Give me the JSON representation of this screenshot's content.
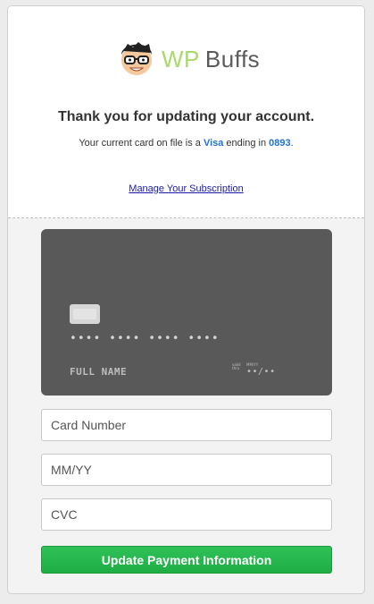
{
  "brand": {
    "logo_primary": "WP",
    "logo_secondary": "Buffs",
    "colors": {
      "logo_primary": "#a8d96a",
      "logo_secondary": "#5b5b5b"
    },
    "mascot_icon": "nerd-face-icon"
  },
  "header": {
    "title": "Thank you for updating your account.",
    "card_info_prefix": "Your current card on file is a ",
    "card_brand": "Visa",
    "card_info_middle": " ending in ",
    "card_last4": "0893",
    "card_info_suffix": ".",
    "manage_link_label": "Manage Your Subscription",
    "colors": {
      "highlight": "#1e73d6",
      "link": "#1a1aa8"
    }
  },
  "card_preview": {
    "number_mask": "•••• •••• •••• ••••",
    "name_placeholder": "FULL NAME",
    "valid_thru_label": "valid thru",
    "expiry_label": "MM/YY",
    "expiry_mask": "••/••",
    "chip_icon": "card-chip-icon",
    "colors": {
      "card_background": "#595959"
    }
  },
  "form": {
    "card_number_placeholder": "Card Number",
    "expiry_placeholder": "MM/YY",
    "cvc_placeholder": "CVC",
    "submit_label": "Update Payment Information",
    "colors": {
      "submit_background": "#22b04a"
    }
  }
}
